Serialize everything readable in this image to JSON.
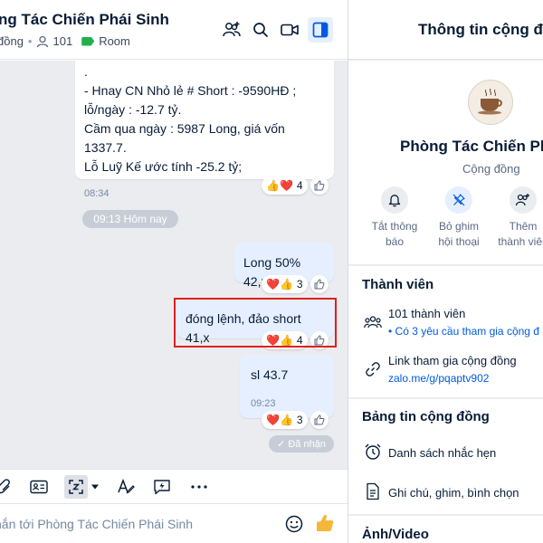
{
  "header": {
    "title": "ng Tác Chiến Phái Sinh",
    "type_label": "đồng",
    "member_count": "101",
    "room_label": "Room"
  },
  "messages": {
    "msg1": {
      "lines": [
        ".",
        "- Hnay CN Nhỏ lẻ # Short : -9590HĐ ;",
        "lỗ/ngày : -12.7 tỷ.",
        "Cầm qua ngày : 5987 Long, giá vốn 1337.7.",
        "Lỗ Luỹ Kế ước tính -25.2 tỷ;"
      ],
      "time": "08:34",
      "reactions": {
        "emojis": "👍❤️",
        "count": "4"
      }
    },
    "date_divider": "09:13 Hôm nay",
    "msg2": {
      "text": "Long 50% 42,x",
      "reactions": {
        "emojis": "❤️👍",
        "count": "3"
      }
    },
    "msg3": {
      "text": "đóng lệnh, đảo short 41,x",
      "reactions": {
        "emojis": "❤️👍",
        "count": "4"
      }
    },
    "msg4": {
      "text": "sl 43.7",
      "time": "09:23",
      "reactions": {
        "emojis": "❤️👍",
        "count": "3"
      }
    },
    "received_status": "✓ Đã nhận"
  },
  "composer": {
    "placeholder": "nắn tới Phòng Tác Chiến Phái Sinh"
  },
  "info_panel": {
    "title": "Thông tin cộng đồ",
    "group_name": "Phòng Tác Chiến Phái",
    "group_type": "Cộng đồng",
    "actions": [
      {
        "label_1": "Tắt thông",
        "label_2": "báo",
        "icon": "bell-icon"
      },
      {
        "label_1": "Bỏ ghim",
        "label_2": "hội thoại",
        "icon": "unpin-icon"
      },
      {
        "label_1": "Thêm",
        "label_2": "thành viên",
        "icon": "add-member-icon"
      }
    ],
    "members_section": {
      "title": "Thành viên",
      "member_count_text": "101 thành viên",
      "join_requests": "• Có 3 yêu cầu tham gia cộng đ",
      "link_title": "Link tham gia cộng đồng",
      "link_url": "zalo.me/g/pqaptv902"
    },
    "board_section": {
      "title": "Bảng tin cộng đồng",
      "reminders": "Danh sách nhắc hẹn",
      "notes": "Ghi chú, ghim, bình chọn"
    },
    "media_section": {
      "title": "Ảnh/Video"
    }
  },
  "colors": {
    "accent": "#005ae0",
    "chat_bg": "#ebecf0",
    "outgoing_bubble": "#e5efff",
    "room_tag": "#20b04b",
    "highlight": "#e02020"
  }
}
